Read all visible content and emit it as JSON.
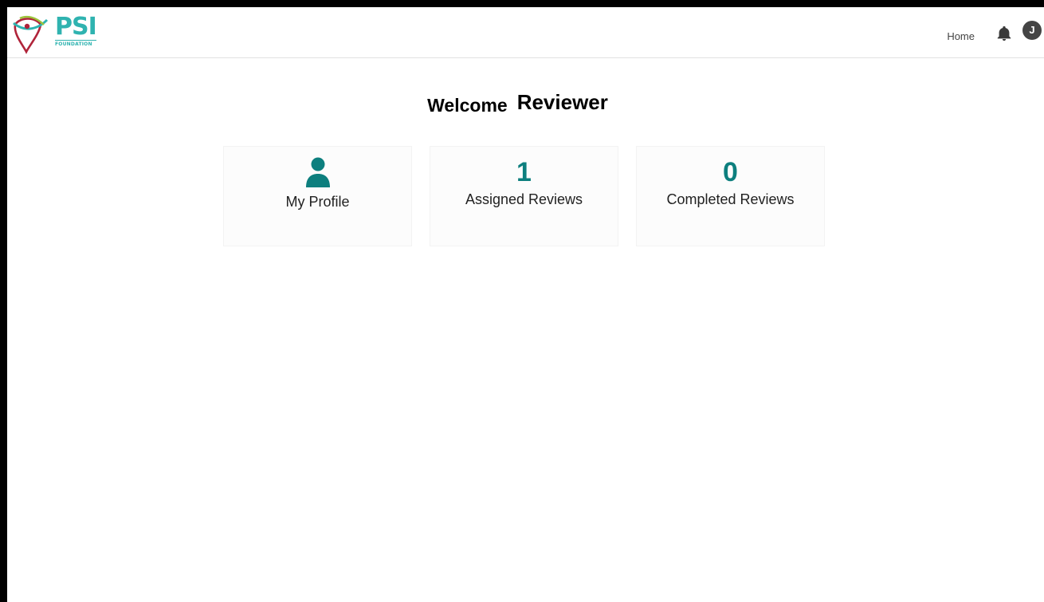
{
  "header": {
    "logo": {
      "name": "PSI",
      "subtitle": "FOUNDATION"
    },
    "nav": {
      "home_label": "Home",
      "notifications_icon": "bell-icon",
      "avatar_initial": "J"
    }
  },
  "main": {
    "welcome_text": "Welcome",
    "role_text": "Reviewer",
    "cards": [
      {
        "icon": "user-icon",
        "label": "My Profile"
      },
      {
        "value": "1",
        "label": "Assigned Reviews"
      },
      {
        "value": "0",
        "label": "Completed Reviews"
      }
    ]
  },
  "colors": {
    "accent": "#0d7f7e",
    "logo_teal": "#2fb3b0",
    "logo_red": "#b0243a",
    "logo_green": "#9cc43b",
    "avatar_bg": "#444444"
  }
}
